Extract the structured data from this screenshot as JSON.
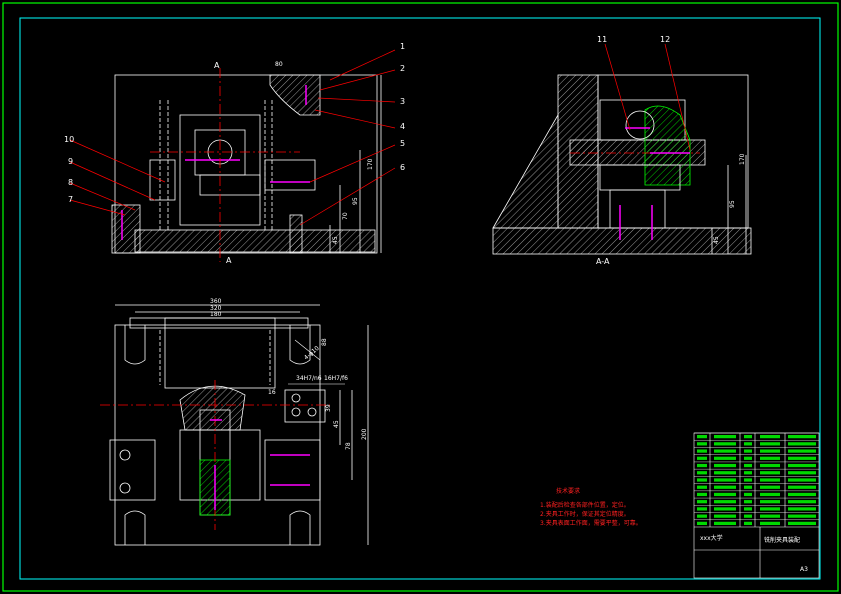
{
  "colors": {
    "frame_outer": "#00ff00",
    "frame_inner": "#00ffff",
    "outline": "#ffffff",
    "leader": "#ff0000",
    "centerline": "#ff0000",
    "hatch": "#ffffff",
    "hatch_green": "#00ff00",
    "bolt": "#ff00ff",
    "note_text": "#ff2020",
    "title_block": "#00ff00"
  },
  "front_view": {
    "section_marks": [
      "A",
      "A"
    ],
    "balloons": [
      "1",
      "2",
      "3",
      "4",
      "5",
      "6",
      "7",
      "8",
      "9",
      "10"
    ],
    "dims": [
      "80",
      "170",
      "95",
      "70",
      "45"
    ]
  },
  "side_view": {
    "caption": "A-A",
    "balloons": [
      "11",
      "12"
    ],
    "dims": [
      "170",
      "95",
      "45"
    ]
  },
  "top_view": {
    "dims_top": [
      "360",
      "320",
      "180"
    ],
    "dims_side": [
      "200",
      "78",
      "45",
      "39",
      "88",
      "16"
    ],
    "dims_misc": [
      "34H7/n6",
      "16H7/f6",
      "4-φ10"
    ]
  },
  "notes": {
    "title": "技术要求",
    "lines": [
      "1.装配后检查各部件位置，定位。",
      "2.夹具工作时，保证其定位精度。",
      "3.夹具表面工作面，需要平整，可靠。"
    ]
  },
  "title_block": {
    "school": "xxx大学",
    "drawing_name": "铣削夹具装配",
    "scale": "A3"
  }
}
